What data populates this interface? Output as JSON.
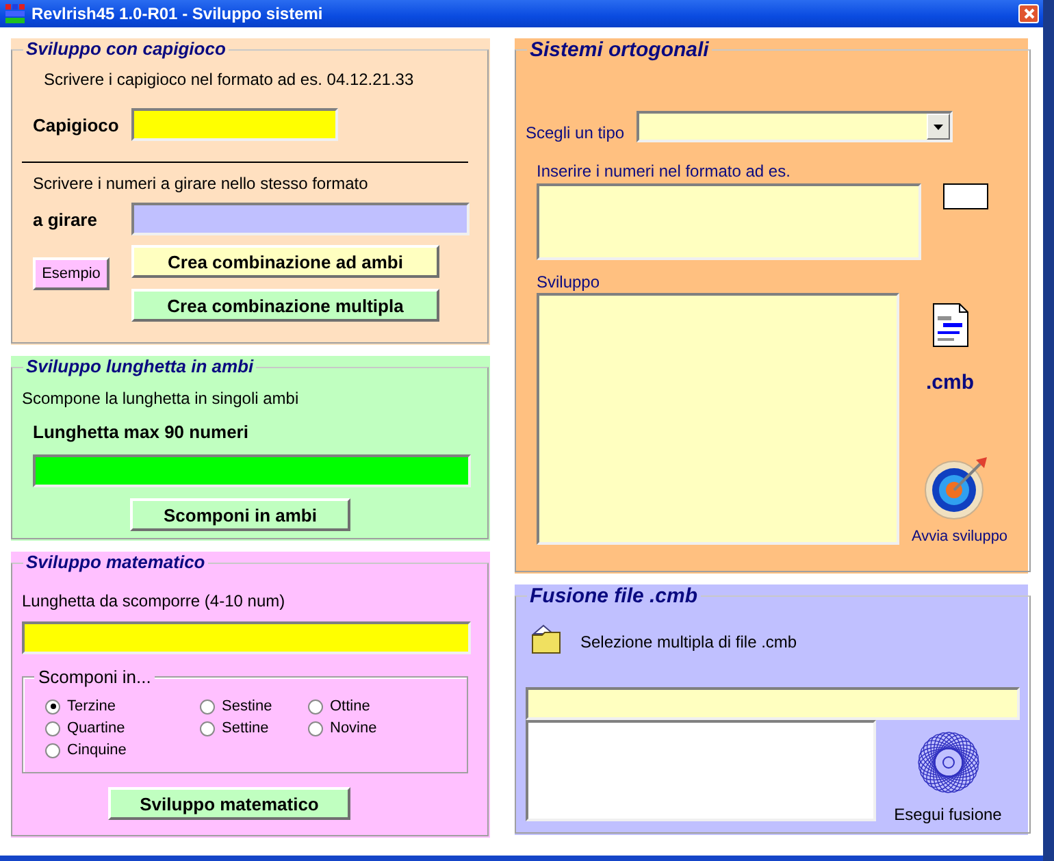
{
  "window": {
    "title": "Revlrish45 1.0-R01 - Sviluppo sistemi"
  },
  "capigioco": {
    "title": "Sviluppo con capigioco",
    "instruction": "Scrivere i capigioco nel formato ad es. 04.12.21.33",
    "field_label": "Capigioco",
    "instruction_2": "Scrivere i numeri a girare nello stesso formato",
    "field_2_label": "a girare",
    "example_button": "Esempio",
    "buttons": [
      "Crea combinazione ad ambi",
      "Crea combinazione multipla"
    ]
  },
  "lunghetta": {
    "title": "Sviluppo lunghetta in ambi",
    "description": "Scompone la lunghetta in singoli ambi",
    "field_label": "Lunghetta max 90 numeri",
    "button": "Scomponi in ambi"
  },
  "matematico": {
    "title": "Sviluppo matematico",
    "field_label": "Lunghetta da scomporre (4-10 num)",
    "group_title": "Scomponi in...",
    "option_columns": [
      [
        {
          "label": "Terzine",
          "selected": true
        },
        {
          "label": "Quartine",
          "selected": false
        },
        {
          "label": "Cinquine",
          "selected": false
        }
      ],
      [
        {
          "label": "Sestine",
          "selected": false
        },
        {
          "label": "Settine",
          "selected": false
        }
      ],
      [
        {
          "label": "Ottine",
          "selected": false
        },
        {
          "label": "Novine",
          "selected": false
        }
      ]
    ],
    "button": "Sviluppo matematico"
  },
  "ortogonali": {
    "title": "Sistemi ortogonali",
    "type_label": "Scegli un tipo",
    "numbers_label": "Inserire i numeri nel formato ad es.",
    "output_label": "Sviluppo",
    "file_ext": ".cmb",
    "run_label": "Avvia sviluppo"
  },
  "fusione": {
    "title": "Fusione file .cmb",
    "select_label": "Selezione multipla di file .cmb",
    "run_label": "Esegui fusione"
  }
}
